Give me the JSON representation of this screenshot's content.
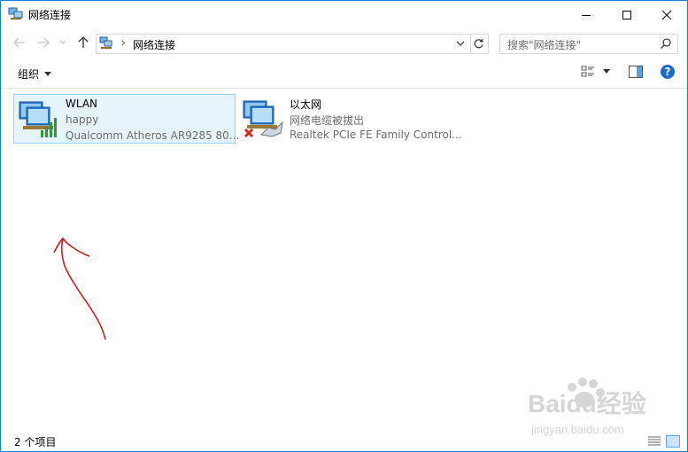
{
  "window": {
    "title": "网络连接",
    "accent": "#1a7fd3"
  },
  "address": {
    "path": "网络连接",
    "separator": "›"
  },
  "search": {
    "placeholder": "搜索\"网络连接\""
  },
  "toolbar": {
    "organize_label": "组织",
    "help_label": "?"
  },
  "connections": [
    {
      "name": "WLAN",
      "status": "happy",
      "device": "Qualcomm Atheros AR9285 80...",
      "icon": "wifi-adapter-icon",
      "selected": true
    },
    {
      "name": "以太网",
      "status": "网络电缆被拔出",
      "device": "Realtek PCIe FE Family Control...",
      "icon": "ethernet-adapter-icon",
      "selected": false
    }
  ],
  "statusbar": {
    "item_count": "2 个项目"
  },
  "watermark": {
    "brand": "Baidu经验",
    "url": "jingyan.baidu.com"
  }
}
